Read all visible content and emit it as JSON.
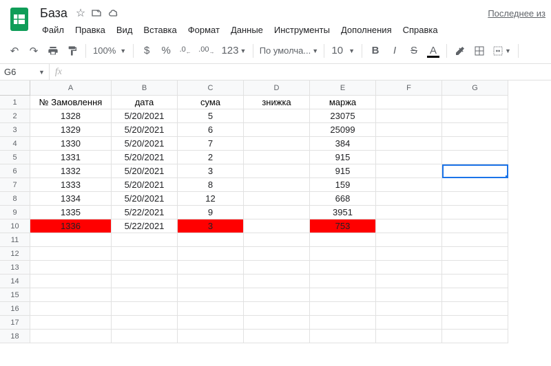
{
  "doc": {
    "title": "База"
  },
  "menus": [
    "Файл",
    "Правка",
    "Вид",
    "Вставка",
    "Формат",
    "Данные",
    "Инструменты",
    "Дополнения",
    "Справка"
  ],
  "last_edit": "Последнее из",
  "toolbar": {
    "zoom": "100%",
    "currency": "$",
    "percent": "%",
    "dec_dec": ".0",
    "inc_dec": ".00",
    "numfmt": "123",
    "font": "По умолча...",
    "size": "10",
    "text_color_letter": "A"
  },
  "namebox": "G6",
  "formula": "",
  "columns": [
    "A",
    "B",
    "C",
    "D",
    "E",
    "F",
    "G"
  ],
  "rownums": [
    1,
    2,
    3,
    4,
    5,
    6,
    7,
    8,
    9,
    10,
    11,
    12,
    13,
    14,
    15,
    16,
    17,
    18
  ],
  "headers": [
    "№ Замовлення",
    "дата",
    "сума",
    "знижка",
    "маржа",
    "",
    ""
  ],
  "data_rows": [
    {
      "a": "1328",
      "b": "5/20/2021",
      "c": "5",
      "d": "",
      "e": "23075",
      "red": false
    },
    {
      "a": "1329",
      "b": "5/20/2021",
      "c": "6",
      "d": "",
      "e": "25099",
      "red": false
    },
    {
      "a": "1330",
      "b": "5/20/2021",
      "c": "7",
      "d": "",
      "e": "384",
      "red": false
    },
    {
      "a": "1331",
      "b": "5/20/2021",
      "c": "2",
      "d": "",
      "e": "915",
      "red": false
    },
    {
      "a": "1332",
      "b": "5/20/2021",
      "c": "3",
      "d": "",
      "e": "915",
      "red": false
    },
    {
      "a": "1333",
      "b": "5/20/2021",
      "c": "8",
      "d": "",
      "e": "159",
      "red": false
    },
    {
      "a": "1334",
      "b": "5/20/2021",
      "c": "12",
      "d": "",
      "e": "668",
      "red": false
    },
    {
      "a": "1335",
      "b": "5/22/2021",
      "c": "9",
      "d": "",
      "e": "3951",
      "red": false
    },
    {
      "a": "1336",
      "b": "5/22/2021",
      "c": "3",
      "d": "",
      "e": "753",
      "red": true
    }
  ],
  "selected_cell": "G6"
}
